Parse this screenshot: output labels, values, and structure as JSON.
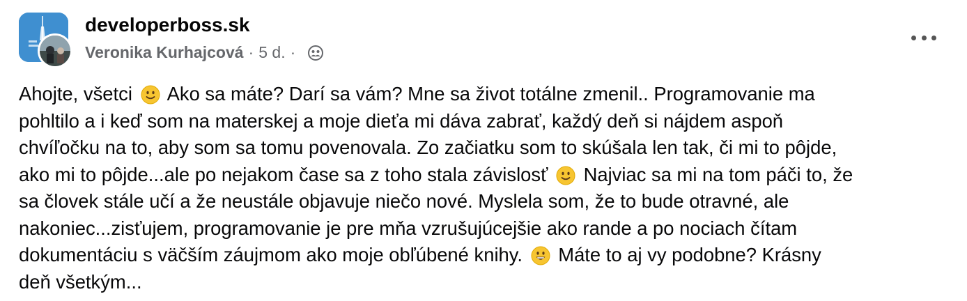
{
  "post": {
    "group_name": "developerboss.sk",
    "author": "Veronika Kurhajcová",
    "time": "5 d.",
    "separator": "·",
    "privacy_icon": "friends-group-icon",
    "more_icon": "more-options-icon",
    "lines": [
      [
        "Ahojte, všetci ",
        "🙂",
        " Ako sa máte? Darí sa vám? Mne sa život totálne zmenil.. Programovanie ma"
      ],
      [
        "pohltilo a i keď som na materskej a moje dieťa mi dáva zabrať, každý deň si nájdem aspoň"
      ],
      [
        "chvíľočku na  to, aby som sa tomu povenovala. Zo začiatku som to skúšala len tak, či mi to pôjde,"
      ],
      [
        "ako mi to pôjde...ale po nejakom čase sa z toho stala závislosť  ",
        "🙂",
        " Najviac sa mi na tom páči to, že"
      ],
      [
        "sa človek stále učí a že neustále objavuje niečo nové. Myslela som, že to bude otravné, ale"
      ],
      [
        "nakoniec...zisťujem, programovanie je pre mňa vzrušujúcejšie ako rande a po nociach čítam"
      ],
      [
        "dokumentáciu s väčším záujmom ako moje obľúbené knihy. ",
        "😀",
        " Máte to aj vy podobne? Krásny"
      ],
      [
        "deň všetkým..."
      ]
    ]
  }
}
